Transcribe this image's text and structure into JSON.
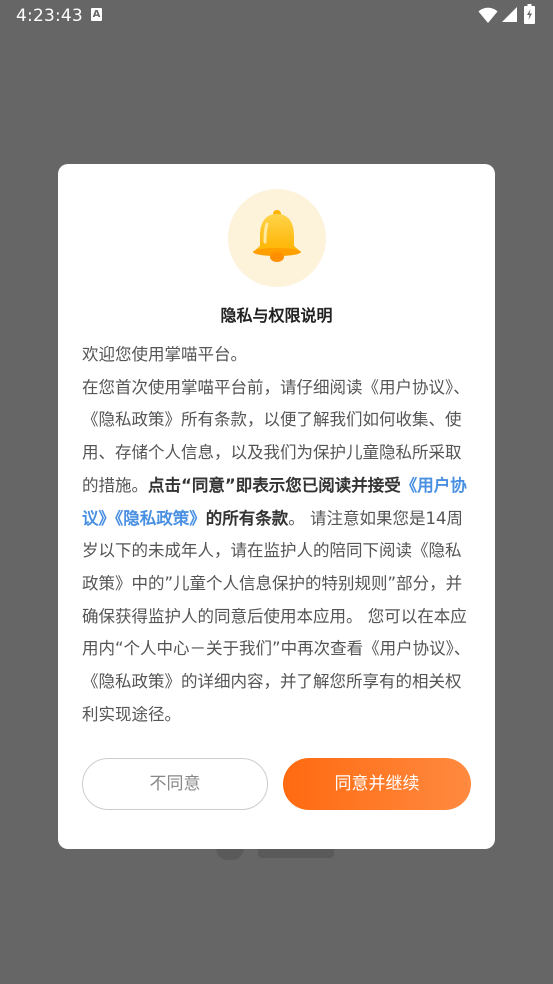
{
  "status_bar": {
    "time": "4:23:43",
    "notification_icon": "a-notification-icon",
    "wifi_icon": "wifi-icon",
    "signal_icon": "cell-signal-icon",
    "battery_icon": "battery-charging-icon"
  },
  "dialog": {
    "icon": "bell-icon",
    "title": "隐私与权限说明",
    "content": {
      "p1": "欢迎您使用掌喵平台。",
      "p2_start": " 在您首次使用掌喵平台前，请仔细阅读《用户协议》、《隐私政策》所有条款，以便了解我们如何收集、使用、存储个人信息，以及我们为保护儿童隐私所采取的措施。",
      "p2_bold1": "点击“同意”即表示您已阅读并接受",
      "p2_link1": "《用户协议》",
      "p2_link2": "《隐私政策》",
      "p2_bold2": "的所有条款",
      "p2_end": "。 请注意如果您是14周岁以下的未成年人，请在监护人的陪同下阅读《隐私政策》中的”儿童个人信息保护的特别规则”部分，并确保获得监护人的同意后使用本应用。 您可以在本应用内“个人中心－关于我们”中再次查看《用户协议》、《隐私政策》的详细内容，并了解您所享有的相关权利实现途径。"
    },
    "buttons": {
      "disagree": "不同意",
      "agree": "同意并继续"
    }
  },
  "colors": {
    "overlay": "#666666",
    "accent_orange": "#ff6a10",
    "link_blue": "#4a90e2",
    "bell_bg": "#fdf2da"
  }
}
